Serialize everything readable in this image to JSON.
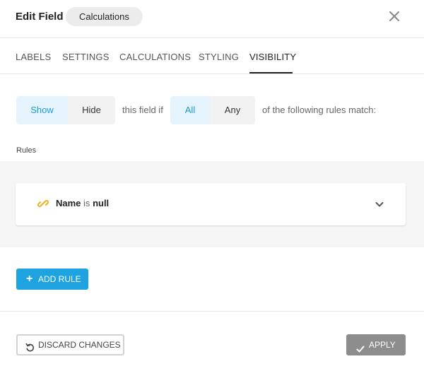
{
  "header": {
    "title": "Edit Field",
    "badge": "Calculations",
    "close_icon": "close-icon"
  },
  "tabs": [
    {
      "label": "LABELS",
      "active": false
    },
    {
      "label": "SETTINGS",
      "active": false
    },
    {
      "label": "CALCULATIONS",
      "active": false
    },
    {
      "label": "STYLING",
      "active": false
    },
    {
      "label": "VISIBILITY",
      "active": true
    }
  ],
  "visibility": {
    "show_label": "Show",
    "hide_label": "Hide",
    "mid_text": "this field if",
    "all_label": "All",
    "any_label": "Any",
    "tail_text": "of the following rules match:",
    "selected_action": "Show",
    "selected_match": "All"
  },
  "rules": {
    "section_label": "Rules",
    "items": [
      {
        "field": "Name",
        "operator": "is",
        "value": "null",
        "icon": "link-icon"
      }
    ],
    "add_label": "ADD RULE"
  },
  "footer": {
    "discard_label": "DISCARD CHANGES",
    "apply_label": "APPLY"
  },
  "colors": {
    "accent": "#1fa3e0",
    "selected_bg": "#e5f4fc",
    "selected_text": "#1a9bd7",
    "apply_bg": "#8d8d8d",
    "link_icon": "#f0b323"
  }
}
